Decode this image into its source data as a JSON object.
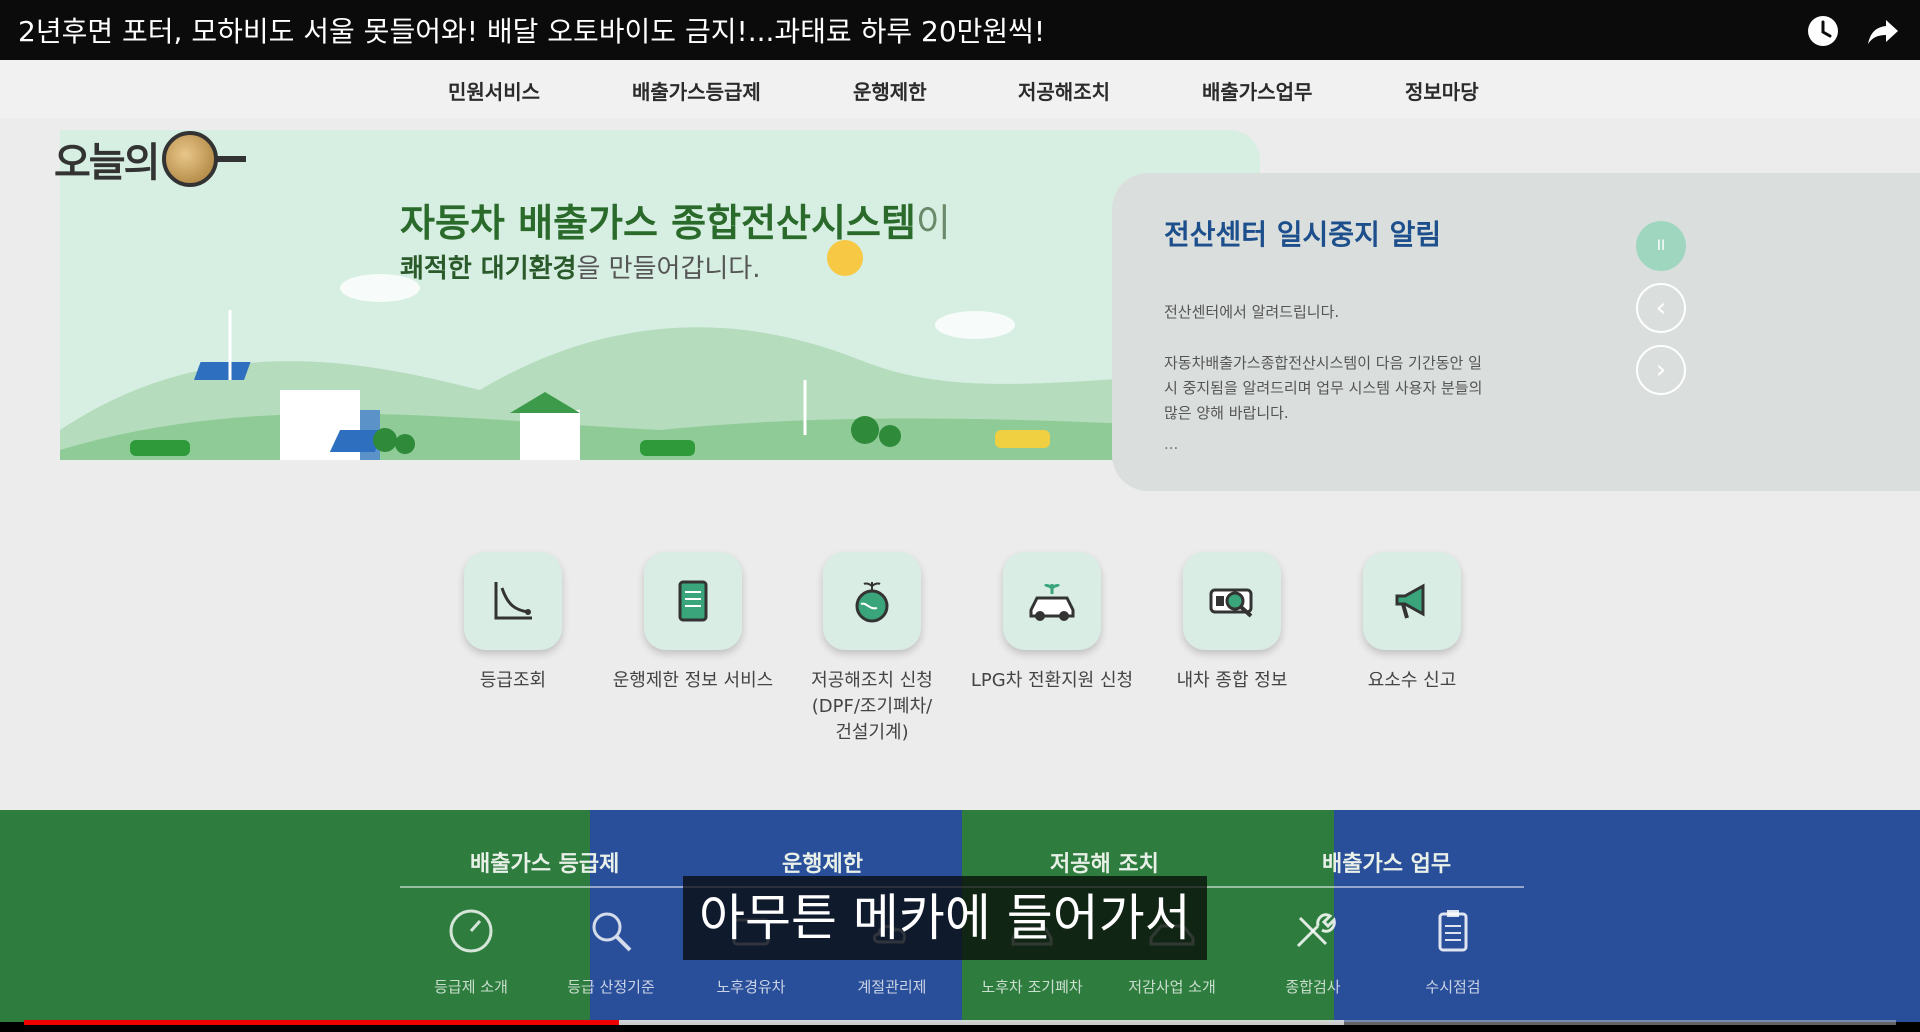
{
  "video": {
    "title": "2년후면 포터, 모하비도 서울 못들어와! 배달 오토바이도 금지!...과태료 하루 20만원씩!",
    "caption": "아무튼 메카에 들어가서",
    "progress": 0.318,
    "buffered": 0.705,
    "icons": [
      "watch-later-icon",
      "share-icon"
    ]
  },
  "site": {
    "logo_text": "오늘의",
    "nav": [
      "민원서비스",
      "배출가스등급제",
      "운행제한",
      "저공해조치",
      "배출가스업무",
      "정보마당"
    ],
    "hero": {
      "headline_main": "자동차 배출가스 종합전산시스템",
      "headline_suffix": "이",
      "subline_bold": "쾌적한 대기환경",
      "subline_rest": "을 만들어갑니다."
    },
    "notice": {
      "title": "전산센터 일시중지 알림",
      "para1": "전산센터에서 알려드립니다.",
      "para2": "자동차배출가스종합전산시스템이 다음 기간동안 일시 중지됨을 알려드리며 업무 시스템 사용자 분들의 많은 양해 바랍니다.",
      "more": "...",
      "pause_symbol": "II",
      "prev_symbol": "‹",
      "next_symbol": "›"
    },
    "services": [
      {
        "label": "등급조회",
        "icon": "chart-icon"
      },
      {
        "label": "운행제한 정보 서비스",
        "icon": "tablet-document-icon"
      },
      {
        "label": "저공해조치 신청\n(DPF/조기폐차/\n건설기계)",
        "icon": "globe-plant-icon"
      },
      {
        "label": "LPG차 전환지원 신청",
        "icon": "eco-car-icon"
      },
      {
        "label": "내차 종합 정보",
        "icon": "car-inspect-icon"
      },
      {
        "label": "요소수 신고",
        "icon": "megaphone-icon"
      }
    ],
    "bottom_tabs": [
      "배출가스 등급제",
      "운행제한",
      "저공해 조치",
      "배출가스 업무"
    ],
    "bottom_items": [
      {
        "label": "등급제 소개",
        "icon": "gauge-icon"
      },
      {
        "label": "등급 산정기준",
        "icon": "magnifier-icon"
      },
      {
        "label": "노후경유차",
        "icon": "truck-icon"
      },
      {
        "label": "계절관리제",
        "icon": "cloud-sun-icon"
      },
      {
        "label": "노후차 조기폐차",
        "icon": "car-icon"
      },
      {
        "label": "저감사업 소개",
        "icon": "car-outline-icon"
      },
      {
        "label": "종합검사",
        "icon": "tools-icon"
      },
      {
        "label": "수시점검",
        "icon": "clipboard-icon"
      }
    ],
    "colors": {
      "green": "#2e7d3f",
      "blue": "#2a4f9a",
      "notice_title": "#1d4f8c",
      "progress_red": "#ee0000"
    }
  }
}
